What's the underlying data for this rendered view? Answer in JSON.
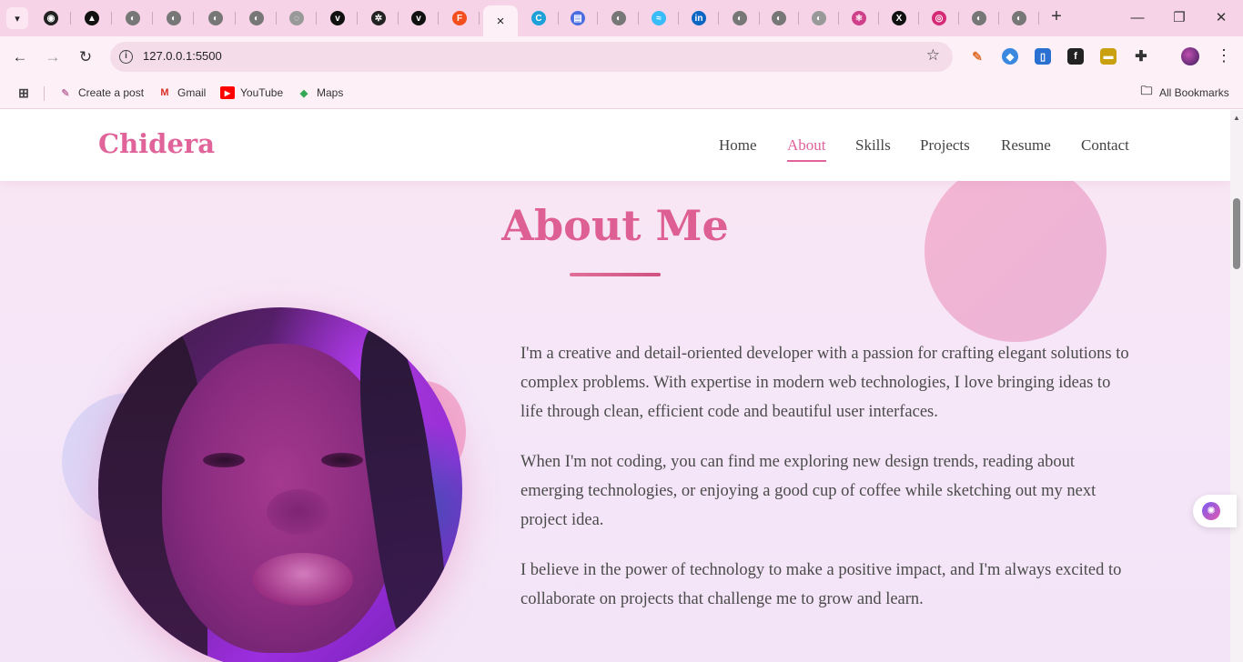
{
  "browser": {
    "tabs": [
      {
        "icon": "github-icon",
        "glyph": "◉",
        "color": "#222222"
      },
      {
        "icon": "triangle-logo-icon",
        "glyph": "▲",
        "color": "#111111"
      },
      {
        "icon": "globe-icon",
        "glyph": "◐",
        "color": "#777777"
      },
      {
        "icon": "globe-icon",
        "glyph": "◐",
        "color": "#777777"
      },
      {
        "icon": "globe-icon",
        "glyph": "◐",
        "color": "#777777"
      },
      {
        "icon": "globe-icon",
        "glyph": "◐",
        "color": "#777777"
      },
      {
        "icon": "loading-icon",
        "glyph": "◌",
        "color": "#999999"
      },
      {
        "icon": "vercel-icon",
        "glyph": "v",
        "color": "#111111"
      },
      {
        "icon": "openai-icon",
        "glyph": "✲",
        "color": "#222222"
      },
      {
        "icon": "vercel-icon",
        "glyph": "v",
        "color": "#111111"
      },
      {
        "icon": "figma-icon",
        "glyph": "F",
        "color": "#f24e1e"
      },
      {
        "icon": "close-icon",
        "glyph": "×",
        "color": "#fdf0f7",
        "active": true
      },
      {
        "icon": "canva-icon",
        "glyph": "C",
        "color": "#1ba0d8"
      },
      {
        "icon": "printer-icon",
        "glyph": "▤",
        "color": "#4a6ee0"
      },
      {
        "icon": "globe-icon",
        "glyph": "◐",
        "color": "#777777"
      },
      {
        "icon": "tailwind-icon",
        "glyph": "≈",
        "color": "#38bdf8"
      },
      {
        "icon": "linkedin-icon",
        "glyph": "in",
        "color": "#0a66c2"
      },
      {
        "icon": "globe-icon",
        "glyph": "◐",
        "color": "#777777"
      },
      {
        "icon": "globe-icon",
        "glyph": "◐",
        "color": "#777777"
      },
      {
        "icon": "globe-icon",
        "glyph": "◐",
        "color": "#999999"
      },
      {
        "icon": "react-icon",
        "glyph": "⚛",
        "color": "#d0408a"
      },
      {
        "icon": "x-icon",
        "glyph": "X",
        "color": "#111111"
      },
      {
        "icon": "instagram-icon",
        "glyph": "◎",
        "color": "#d62976"
      },
      {
        "icon": "globe-icon",
        "glyph": "◐",
        "color": "#777777"
      },
      {
        "icon": "globe-icon",
        "glyph": "◐",
        "color": "#777777"
      }
    ],
    "url": "127.0.0.1:5500",
    "bookmarks": [
      {
        "label": "Create a post",
        "icon": "post-icon"
      },
      {
        "label": "Gmail",
        "icon": "gmail-icon"
      },
      {
        "label": "YouTube",
        "icon": "youtube-icon"
      },
      {
        "label": "Maps",
        "icon": "maps-icon"
      }
    ],
    "all_bookmarks": "All Bookmarks"
  },
  "site": {
    "brand": "Chidera",
    "nav": [
      "Home",
      "About",
      "Skills",
      "Projects",
      "Resume",
      "Contact"
    ],
    "active_nav": "About",
    "accent_color": "#e0639a"
  },
  "about": {
    "title": "About Me",
    "paragraphs": [
      "I'm a creative and detail-oriented developer with a passion for crafting elegant solutions to complex problems. With expertise in modern web technologies, I love bringing ideas to life through clean, efficient code and beautiful user interfaces.",
      "When I'm not coding, you can find me exploring new design trends, reading about emerging technologies, or enjoying a good cup of coffee while sketching out my next project idea.",
      "I believe in the power of technology to make a positive impact, and I'm always excited to collaborate on projects that challenge me to grow and learn."
    ]
  }
}
